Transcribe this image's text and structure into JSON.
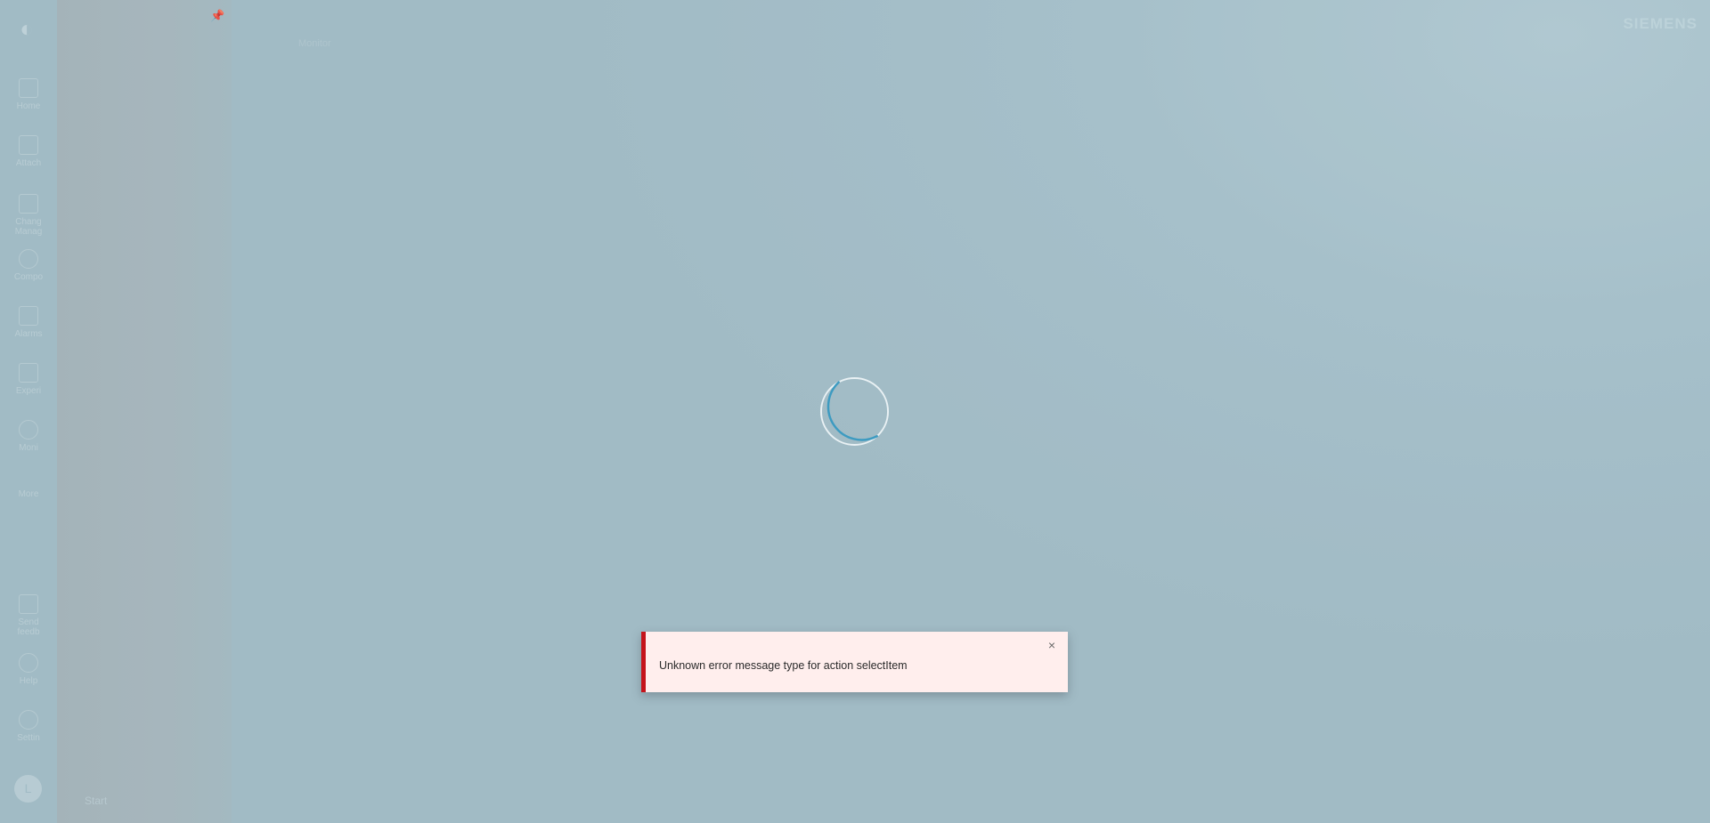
{
  "rail": {
    "logo_icon": "app-logo-icon",
    "items": [
      {
        "label": "Home",
        "icon": "home-icon"
      },
      {
        "label": "Attach",
        "icon": "attach-icon"
      },
      {
        "label": "Chang\nManag",
        "icon": "change-management-icon"
      },
      {
        "label": "Compo",
        "icon": "components-icon"
      },
      {
        "label": "Alarms",
        "icon": "alarm-icon"
      },
      {
        "label": "Experi\n",
        "icon": "experience-icon"
      },
      {
        "label": "Moni",
        "icon": "monitoring-icon"
      },
      {
        "label": "More",
        "icon": "more-icon"
      },
      {
        "label": "Send\nfeedb",
        "icon": "feedback-icon"
      },
      {
        "label": "Help",
        "icon": "help-icon"
      },
      {
        "label": "Settin",
        "icon": "settings-icon"
      }
    ],
    "avatar_text": "L"
  },
  "panel": {
    "pin_icon": "pin-icon",
    "start_label": "Start"
  },
  "header": {
    "breadcrumb": "Monitor",
    "brand": "SIEMENS"
  },
  "toast": {
    "message": "Unknown error message type for action selectItem",
    "close_symbol": "×",
    "accent_color": "#c5131b",
    "background_color": "#ffeeed"
  },
  "spinner": {
    "active_color": "#3d9bc1",
    "track_color": "#e9f1f4"
  }
}
